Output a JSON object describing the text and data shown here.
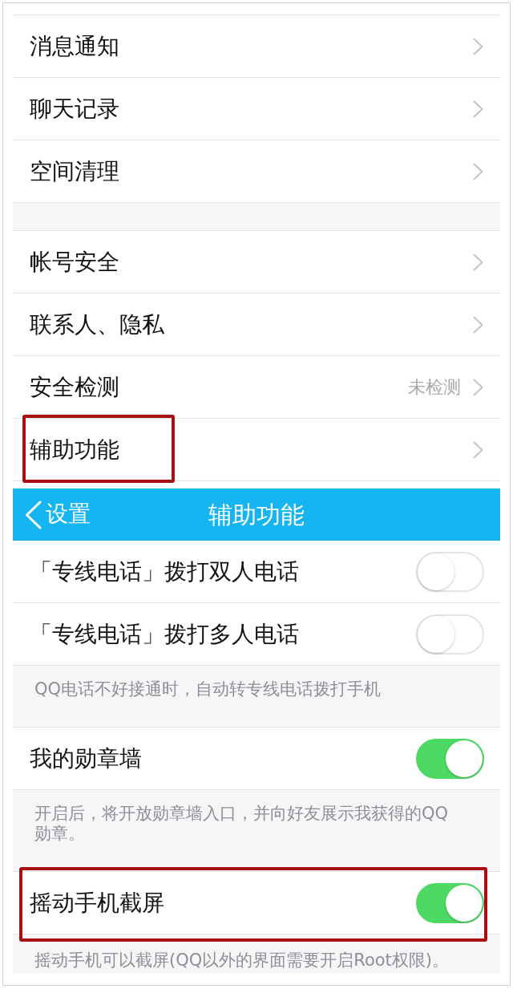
{
  "settings": {
    "groups": [
      {
        "items": [
          {
            "label": "消息通知",
            "circled": false
          },
          {
            "label": "聊天记录",
            "circled": false
          },
          {
            "label": "空间清理",
            "circled": false
          }
        ]
      },
      {
        "items": [
          {
            "label": "帐号安全",
            "circled": false
          },
          {
            "label": "联系人、隐私",
            "circled": false
          },
          {
            "label": "安全检测",
            "value": "未检测",
            "circled": false
          },
          {
            "label": "辅助功能",
            "circled": true
          }
        ]
      }
    ]
  },
  "accessibility": {
    "header": {
      "back_label": "设置",
      "title": "辅助功能"
    },
    "sections": [
      {
        "rows": [
          {
            "label": "「专线电话」拨打双人电话",
            "on": false,
            "circled": false
          },
          {
            "label": "「专线电话」拨打多人电话",
            "on": false,
            "circled": false
          }
        ],
        "note": "QQ电话不好接通时，自动转专线电话拨打手机"
      },
      {
        "rows": [
          {
            "label": "我的勋章墙",
            "on": true,
            "circled": false
          }
        ],
        "note": "开启后，将开放勋章墙入口，并向好友展示我获得的QQ勋章。"
      },
      {
        "rows": [
          {
            "label": "摇动手机截屏",
            "on": true,
            "circled": true
          }
        ],
        "note": "摇动手机可以截屏(QQ以外的界面需要开启Root权限)。"
      }
    ]
  }
}
